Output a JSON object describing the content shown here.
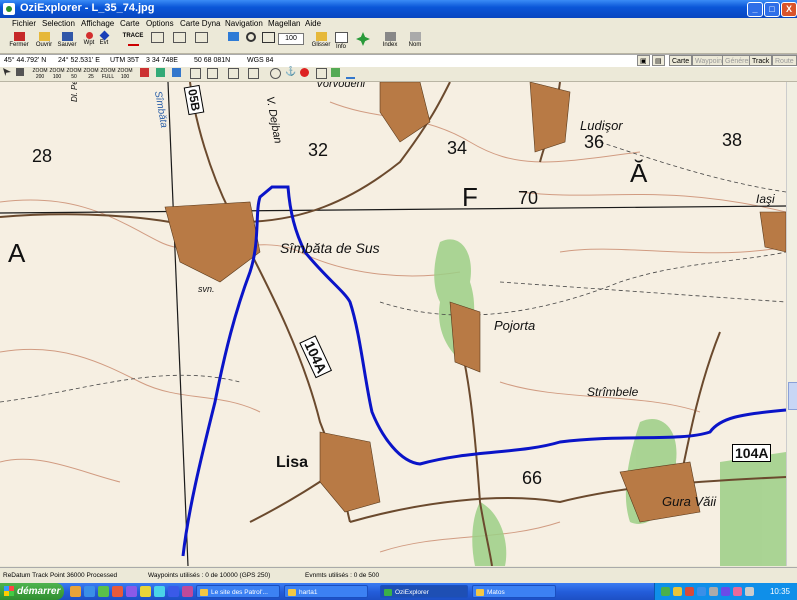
{
  "window": {
    "title": "OziExplorer - L_35_74.jpg",
    "minimize": "_",
    "maximize": "□",
    "close": "X"
  },
  "menu": [
    "Fichier",
    "Selection",
    "Affichage",
    "Carte",
    "Options",
    "Carte Dyna",
    "Navigation",
    "Magellan",
    "Aide"
  ],
  "toolbar": {
    "fermer": "Fermer",
    "ouvrir": "Ouvrir",
    "sauver": "Sauver",
    "wpt": "Wpt",
    "evt": "Evt",
    "trace": "TRACE",
    "zoom_value": "100",
    "glisser": "Glisser",
    "info": "Info",
    "index": "Index",
    "nom": "Nom"
  },
  "coords": {
    "lat": "45° 44.792' N",
    "lon": "24° 52.531' E",
    "zone": "UTM 35T",
    "easting": "3 34 748E",
    "northing": "50 68 081N",
    "datum": "WGS 84"
  },
  "right_buttons": {
    "carte": "Carte",
    "waypoint": "Waypoint",
    "generer": "Générer",
    "track": "Track",
    "route": "Route"
  },
  "toolbar2": [
    "ZOOM 200",
    "ZOOM 100",
    "ZOOM 50",
    "ZOOM 25",
    "ZOOM FULL",
    "ZOOM 100"
  ],
  "map": {
    "place_names": [
      "Vorvodeni",
      "Ludişor",
      "V. Dejban",
      "Sîmbăta",
      "Sîmbăta de Sus",
      "Pojorta",
      "Strîmbele",
      "Lisa",
      "Gura Văii",
      "Iaşi",
      "svn.",
      "Dl. Persorilă"
    ],
    "grid_numbers": [
      "28",
      "32",
      "34",
      "36",
      "38",
      "70",
      "66"
    ],
    "grid_letters": [
      "A",
      "F",
      "Ă"
    ],
    "road_labels": [
      "05B",
      "104A",
      "104A"
    ],
    "route_color": "#0a14c8"
  },
  "status": {
    "left": "ReDatum Track Point 36000 Processed",
    "waypoints": "Waypoints utilisés : 0 de 10000  (GPS 250)",
    "events": "Evnmts utilisés : 0 de 500"
  },
  "taskbar": {
    "start": "démarrer",
    "tasks": [
      "Le site des Patrol'...",
      "harta1",
      "OziExplorer",
      "Matos"
    ],
    "clock": "10:35"
  }
}
